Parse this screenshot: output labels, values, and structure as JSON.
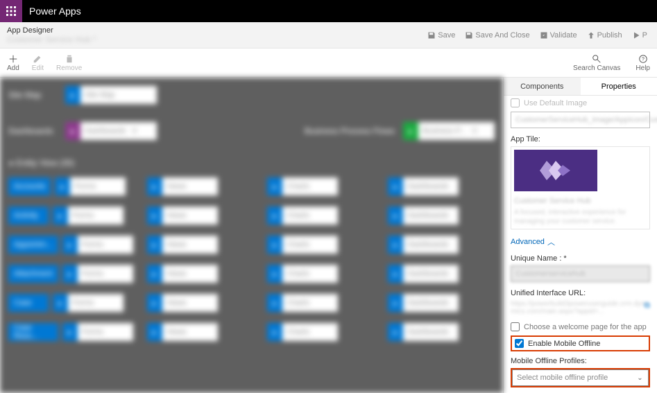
{
  "titlebar": {
    "app_name": "Power Apps"
  },
  "breadcrumb": {
    "designer": "App Designer",
    "app_title": "Customer Service Hub *",
    "commands": {
      "save": "Save",
      "save_and_close": "Save And Close",
      "validate": "Validate",
      "publish": "Publish",
      "play": "P"
    }
  },
  "toolbar": {
    "add": "Add",
    "edit": "Edit",
    "remove": "Remove",
    "search": "Search Canvas",
    "help": "Help"
  },
  "tabs": {
    "components": "Components",
    "properties": "Properties"
  },
  "properties": {
    "use_default_image": "Use Default Image",
    "image_dropdown": "CustomerServiceHub_image/AppIcon/Customer...",
    "app_tile_label": "App Tile:",
    "tile_title": "Customer Service Hub",
    "tile_desc": "A focused, interactive experience for managing your customer service.",
    "advanced": "Advanced",
    "unique_name_label": "Unique Name : *",
    "unique_name_value": "Customerservicehub",
    "url_label": "Unified Interface URL:",
    "url_value": "https://powerbuild3poweruserguide.crm.dynamics.com/main.aspx?appid=...",
    "welcome_page": "Choose a welcome page for the app",
    "enable_offline": "Enable Mobile Offline",
    "profiles_label": "Mobile Offline Profiles:",
    "profiles_placeholder": "Select mobile offline profile"
  }
}
